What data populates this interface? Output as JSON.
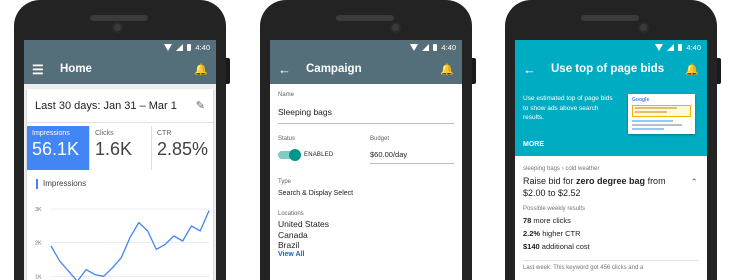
{
  "statusbar_time": "4:40",
  "phone1": {
    "appbar": {
      "menu_icon": "menu-icon",
      "title": "Home",
      "bell_icon": "bell-icon"
    },
    "date_range": "Last 30 days: Jan 31 – Mar 1",
    "edit_icon": "pencil-icon",
    "metrics": [
      {
        "label": "Impressions",
        "value": "56.1K",
        "active": true
      },
      {
        "label": "Clicks",
        "value": "1.6K",
        "active": false
      },
      {
        "label": "CTR",
        "value": "2.85%",
        "active": false
      }
    ],
    "chart_title": "Impressions",
    "chart_data": {
      "type": "line",
      "title": "Impressions",
      "ylabel": "",
      "y_ticks": [
        "3K",
        "2K",
        "1K"
      ],
      "ylim": [
        800,
        3300
      ],
      "x": [
        1,
        2,
        3,
        4,
        5,
        6,
        7,
        8,
        9,
        10,
        11,
        12,
        13,
        14,
        15,
        16,
        17,
        18,
        19
      ],
      "values": [
        1900,
        1450,
        1150,
        850,
        1200,
        1050,
        1000,
        1250,
        1550,
        2150,
        2600,
        2350,
        1800,
        1950,
        2200,
        2050,
        2500,
        2350,
        2950
      ],
      "series_color": "#4285f4",
      "grid": true
    },
    "accent_color": "#4285f4"
  },
  "phone2": {
    "appbar": {
      "back_icon": "back-arrow-icon",
      "title": "Campaign",
      "bell_icon": "bell-icon"
    },
    "name_label": "Name",
    "name_value": "Sleeping bags",
    "status_label": "Status",
    "status_value": "ENABLED",
    "budget_label": "Budget",
    "budget_value": "$60.00/day",
    "type_label": "Type",
    "type_value": "Search & Display Select",
    "locations_label": "Locations",
    "locations": [
      "United States",
      "Canada",
      "Brazil"
    ],
    "view_all": "View All",
    "toggle_color": "#009688"
  },
  "phone3": {
    "appbar": {
      "back_icon": "back-arrow-icon",
      "title": "Use top of page bids",
      "bell_icon": "bell-icon"
    },
    "tip_text": "Use estimated top of page bids to show ads above search results.",
    "more_label": "MORE",
    "thumb_logo": "Google",
    "breadcrumb": "sleeping bags › cold weather",
    "raise_prefix": "Raise bid for ",
    "raise_keyword": "zero degree bag",
    "raise_suffix": " from $2.00 to $2.52",
    "weekly_label": "Possible weekly results",
    "stats": [
      {
        "bold": "78",
        "text": " more clicks"
      },
      {
        "bold": "2.2%",
        "text": " higher CTR"
      },
      {
        "bold": "$140",
        "text": " additional cost"
      }
    ],
    "last_week": "Last week: This keyword got 456 clicks and a",
    "accent_color": "#00acc1"
  }
}
